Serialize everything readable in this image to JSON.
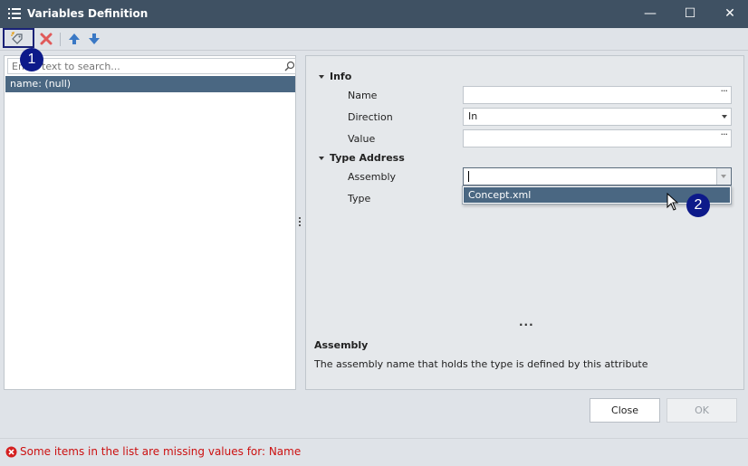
{
  "window": {
    "title": "Variables Definition",
    "minimize": "—",
    "maximize": "☐",
    "close": "✕"
  },
  "left": {
    "search_placeholder": "Enter text to search...",
    "items": [
      {
        "label": "name: (null)"
      }
    ]
  },
  "properties": {
    "categories": {
      "info": "Info",
      "type_address": "Type Address"
    },
    "name": {
      "label": "Name",
      "value": ""
    },
    "direction": {
      "label": "Direction",
      "value": "In"
    },
    "value": {
      "label": "Value",
      "value": ""
    },
    "assembly": {
      "label": "Assembly",
      "value": ""
    },
    "type": {
      "label": "Type",
      "value": ""
    },
    "dropdown_options": [
      "Concept.xml"
    ],
    "ellipsis": "···",
    "more": "···"
  },
  "description": {
    "title": "Assembly",
    "text": "The assembly name that holds the type is defined by this attribute"
  },
  "buttons": {
    "close": "Close",
    "ok": "OK"
  },
  "status": {
    "message": "Some items in the list are missing values for: Name"
  },
  "markers": [
    "1",
    "2"
  ],
  "colors": {
    "titlebar": "#3f5163",
    "selection": "#4a6782",
    "marker": "#0d1a8a",
    "error": "#cc1111"
  }
}
